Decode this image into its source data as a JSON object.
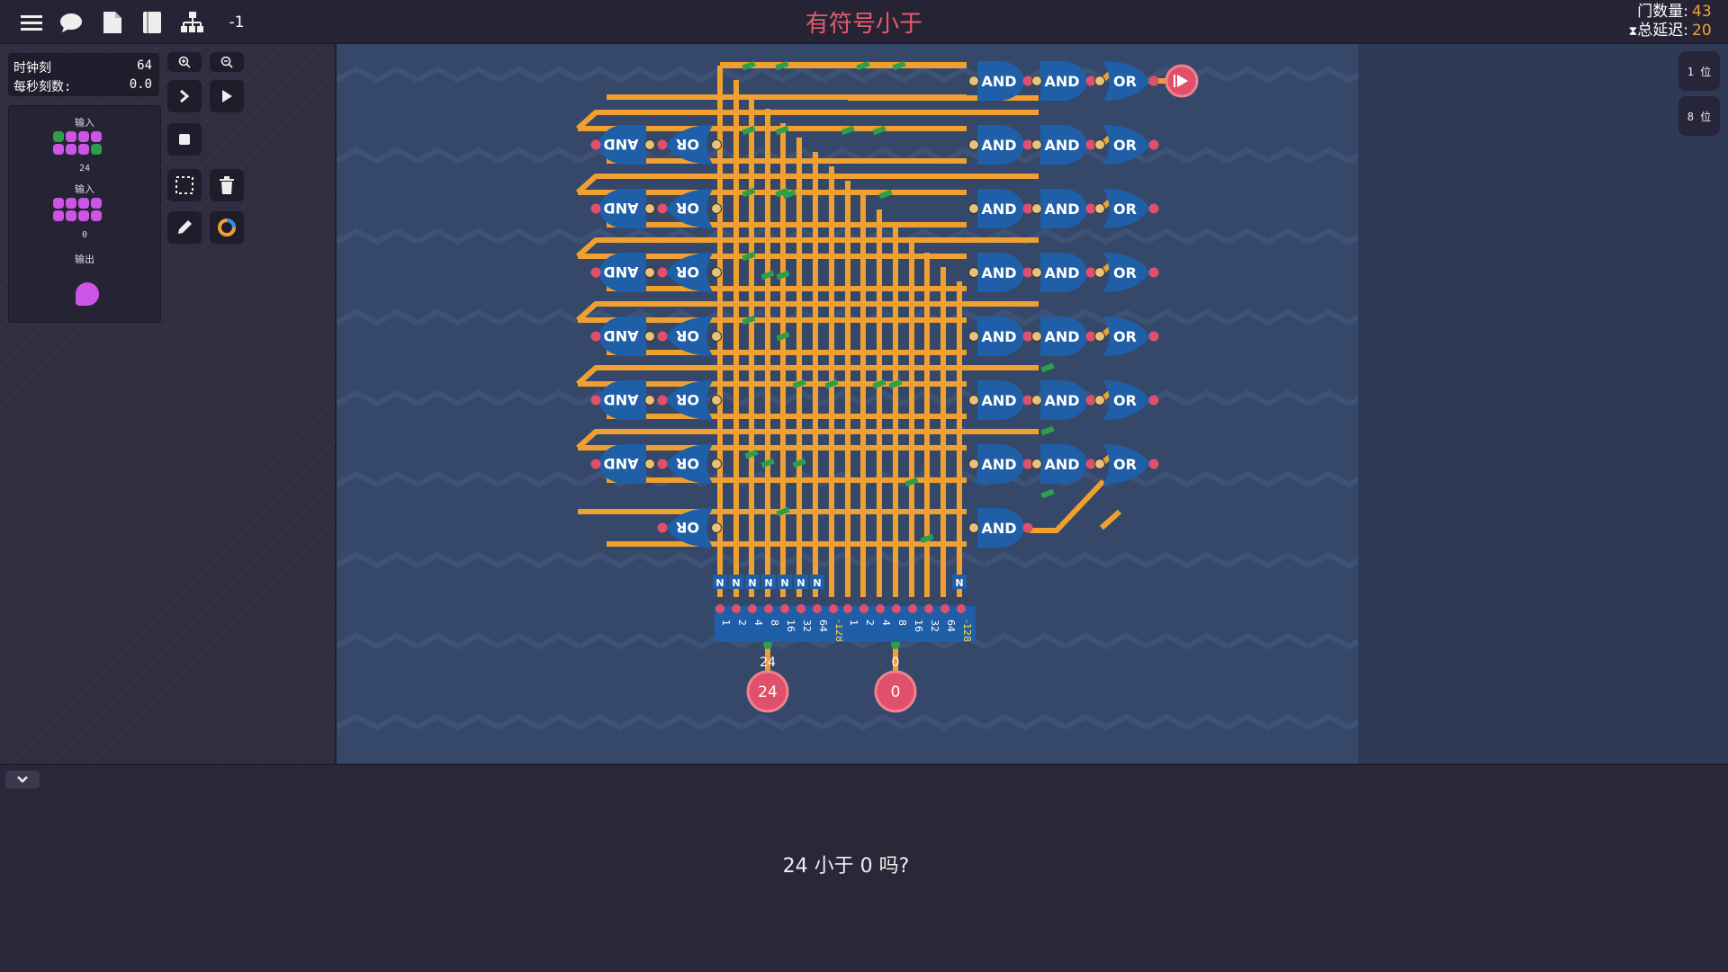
{
  "toolbar": {
    "level_offset": "-1",
    "icons": [
      "menu-icon",
      "chat-icon",
      "document-icon",
      "book-icon",
      "hierarchy-icon"
    ]
  },
  "title": "有符号小于",
  "stats": {
    "gate_count_label": "门数量:",
    "gate_count": "43",
    "total_delay_label": "总延迟:",
    "total_delay": "20"
  },
  "clock": {
    "tick_label": "时钟刻",
    "tick_value": "64",
    "tps_label": "每秒刻数:",
    "tps_value": "0.0"
  },
  "components": {
    "input1_label": "输入",
    "input1_value": "24",
    "input2_label": "输入",
    "input2_value": "0",
    "output_label": "输出"
  },
  "bit_buttons": [
    "1 位",
    "8 位"
  ],
  "circuit": {
    "gate_labels": {
      "and": "AND",
      "or": "OR"
    },
    "input_a_value": "24",
    "input_b_value": "0",
    "decoder_a_bits": [
      "1",
      "2",
      "4",
      "8",
      "16",
      "32",
      "64",
      "-128"
    ],
    "decoder_b_bits": [
      "1",
      "2",
      "4",
      "8",
      "16",
      "32",
      "64",
      "-128"
    ]
  },
  "question": "24 小于 0 吗?",
  "colors": {
    "wire": "#f0a030",
    "gate": "#1f5fa8",
    "pin_red": "#e0506a",
    "pin_green": "#2e9e4a",
    "title": "#e65c6e",
    "stat_value": "#f4a233"
  }
}
